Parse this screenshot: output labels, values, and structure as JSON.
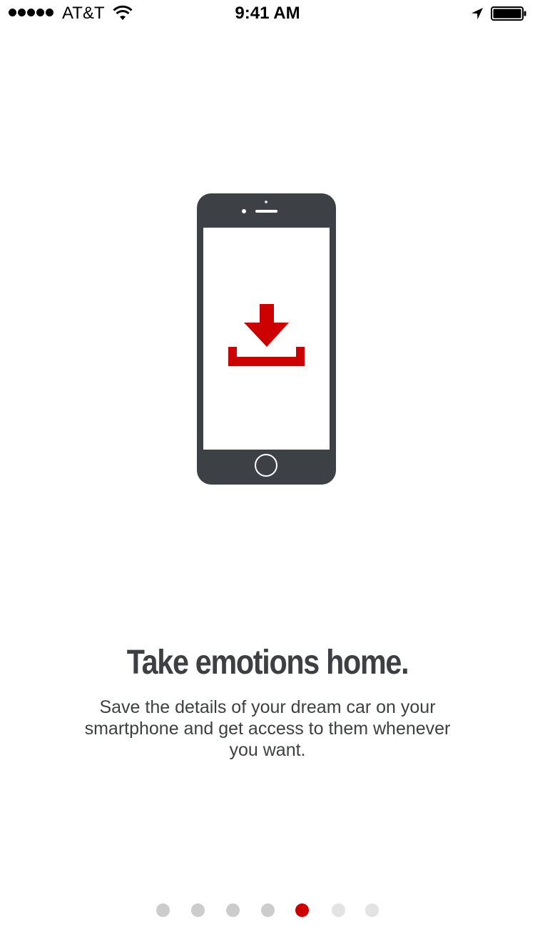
{
  "status_bar": {
    "carrier": "AT&T",
    "time": "9:41 AM",
    "signal_bars": 5,
    "battery_level": 1.0,
    "icons": [
      "signal-dots-icon",
      "wifi-icon",
      "location-arrow-icon",
      "battery-icon"
    ]
  },
  "illustration": {
    "icons": [
      "smartphone-icon",
      "download-icon"
    ],
    "colors": {
      "device": "#3d4045",
      "screen": "#ffffff",
      "accent": "#cc0000"
    }
  },
  "content": {
    "headline": "Take emotions home.",
    "body": "Save the details of your dream car on your smartphone and get access to them whenever you want."
  },
  "pager": {
    "total": 7,
    "current": 5,
    "colors": {
      "active": "#cc0000",
      "visited": "#cccccc",
      "upcoming": "#e3e3e3"
    }
  }
}
